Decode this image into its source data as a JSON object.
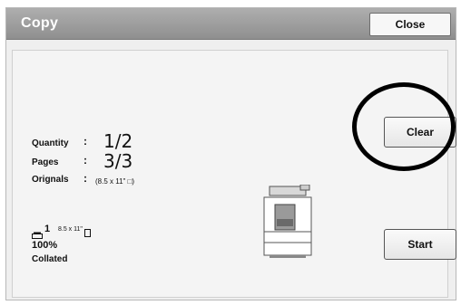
{
  "window": {
    "title": "Copy",
    "close_label": "Close"
  },
  "summary": {
    "quantity_label": "Quantity",
    "quantity_value": "1/2",
    "pages_label": "Pages",
    "pages_value": "3/3",
    "originals_label": "Orignals",
    "originals_value": "(8.5 x 11\" □)",
    "separator": ":"
  },
  "output": {
    "tray": "1",
    "paper": "8.5 x 11\"",
    "zoom": "100%",
    "finishing": "Collated"
  },
  "buttons": {
    "clear_label": "Clear",
    "start_label": "Start"
  },
  "icons": {
    "tray": "paper-tray-icon",
    "paper_orientation": "paper-orientation-icon",
    "printer": "copier-machine-icon"
  }
}
